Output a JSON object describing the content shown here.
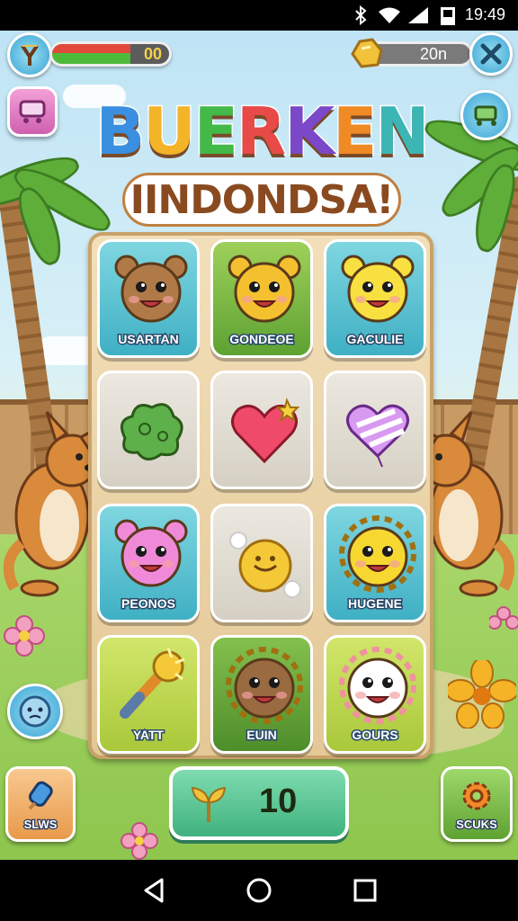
{
  "status_bar": {
    "time": "19:49",
    "icons": [
      "bluetooth-icon",
      "wifi-icon",
      "signal-icon",
      "battery-icon"
    ]
  },
  "hud": {
    "health_value": "00",
    "health_fill_fraction": 0.67,
    "coins_value": "20n"
  },
  "title": {
    "main": "BUERKEN",
    "main_letter_colors": [
      "#3b8fe0",
      "#f3b428",
      "#42b948",
      "#e84a48",
      "#7a48c8",
      "#ef8a24",
      "#3bb6b4"
    ],
    "sub": "IINDONDSA!"
  },
  "board": {
    "tiles": [
      {
        "label": "USARTAN",
        "icon": "beaver-face-icon",
        "color": "teal"
      },
      {
        "label": "GONDEOE",
        "icon": "bear-face-icon",
        "color": "green"
      },
      {
        "label": "GACULIE",
        "icon": "yellow-bear-face-icon",
        "color": "teal"
      },
      {
        "label": "",
        "icon": "green-blob-icon",
        "color": "gray"
      },
      {
        "label": "",
        "icon": "heart-icon",
        "color": "gray"
      },
      {
        "label": "",
        "icon": "striped-balloon-heart-icon",
        "color": "gray"
      },
      {
        "label": "PEONOS",
        "icon": "pink-bear-face-icon",
        "color": "teal"
      },
      {
        "label": "",
        "icon": "sun-puff-icon",
        "color": "gray"
      },
      {
        "label": "HUGENE",
        "icon": "sunflower-face-icon",
        "color": "teal"
      },
      {
        "label": "YATT",
        "icon": "sparkle-wand-icon",
        "color": "lime"
      },
      {
        "label": "EUIN",
        "icon": "brown-chestnut-face-icon",
        "color": "dgreen"
      },
      {
        "label": "GOURS",
        "icon": "white-flower-face-icon",
        "color": "lime"
      }
    ]
  },
  "controls": {
    "left_button_label": "SLWS",
    "right_button_label": "SCUKS",
    "score_value": "10"
  }
}
